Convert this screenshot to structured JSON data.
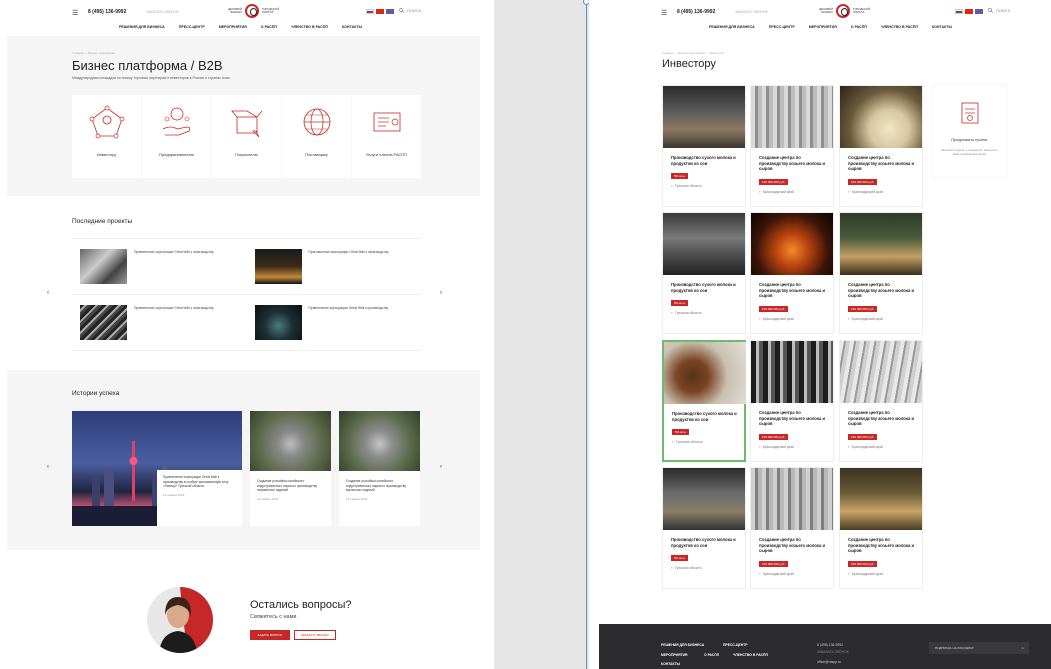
{
  "header": {
    "phone": "8 (495) 136-9992",
    "callback": "ЗАКАЗАТЬ ЗВОНОК",
    "logo_left": "ДЕЛОВОЙ БИЗНЕС",
    "logo_right": "ГОРОДСКОЙ ПОРТАЛ",
    "search": "ПОИСК",
    "nav": [
      "РЕШЕНИЯ ДЛЯ БИЗНЕСА",
      "ПРЕСС-ЦЕНТР",
      "МЕРОПРИЯТИЯ",
      "О РАСПП",
      "ЧЛЕНСТВО В РАСПП",
      "КОНТАКТЫ"
    ]
  },
  "left": {
    "breadcrumb": "Главная  —  Бизнес-платформа",
    "title": "Бизнес платформа / B2B",
    "lead": "Международная площадка по поиску торговых партнеров и инвесторов в России и странах Азии",
    "roles": [
      "Инвестору",
      "Предпринимателю",
      "Покупателю",
      "Поставщику",
      "Услуги членов РАСПП"
    ],
    "recent_title": "Последние проекты",
    "projects": [
      "Привлечение корпорации Great Wall к производству",
      "Приглашение корпорации Great Wall к производству",
      "Привлечение корпорации Great Wall к производству",
      "Привлечение корпорации Great Wall к производству"
    ],
    "stories_title": "Истории успеха",
    "story_big": "Привлечение корпорации Great Wall к производству в особую экономическую зону «Липецк» Тульской области",
    "story_big_date": "21 января 2022",
    "story_small": [
      {
        "text": "Создание российско-китайского индустриального парка по производству пальмистых изделий",
        "date": "21 января 2022"
      },
      {
        "text": "Создание российско-китайского индустриального парка по производству кирпичных изделий",
        "date": "21 января 2022"
      }
    ],
    "questions_title": "Остались вопросы?",
    "questions_sub": "Свяжитесь с нами",
    "btn_ask": "ЗАДАТЬ ВОПРОС",
    "btn_call": "ЗАКАЗАТЬ ЗВОНОК"
  },
  "right": {
    "breadcrumb": "Главная  —  Бизнес-платформа  —  Инвестору",
    "title": "Инвестору",
    "cards": [
      {
        "title": "Производство сухого молока и продуктов из сои",
        "price": "5% млн.",
        "location": "Тульская область"
      },
      {
        "title": "Создание центра по производству козьего молока и сыров",
        "price": "160 000 000 руб.",
        "location": "Краснодарский край"
      },
      {
        "title": "Создание центра по производству козьего молока и сыров",
        "price": "160 000 000 руб.",
        "location": "Краснодарский край"
      },
      {
        "title": "Производство сухого молока и продуктов из сои",
        "price": "5% млн.",
        "location": "Тульская область"
      },
      {
        "title": "Создание центра по производству козьего молока и сыров",
        "price": "160 000 000 руб.",
        "location": "Краснодарский край"
      },
      {
        "title": "Создание центра по производству козьего молока и сыров",
        "price": "160 000 000 руб.",
        "location": "Краснодарский край"
      },
      {
        "title": "Производство сухого молока и продуктов из сои",
        "price": "5% млн.",
        "location": "Тульская область"
      },
      {
        "title": "Создание центра по производству козьего молока и сыров",
        "price": "160 000 000 руб.",
        "location": "Краснодарский край"
      },
      {
        "title": "Создание центра по производству козьего молока и сыров",
        "price": "160 000 000 руб.",
        "location": "Краснодарский край"
      },
      {
        "title": "Производство сухого молока и продуктов из сои",
        "price": "5% млн.",
        "location": "Тульская область"
      },
      {
        "title": "Создание центра по производству козьего молока и сыров",
        "price": "160 000 000 руб.",
        "location": "Краснодарский край"
      },
      {
        "title": "Создание центра по производству козьего молока и сыров",
        "price": "160 000 000 руб.",
        "location": "Краснодарский край"
      }
    ],
    "offer_title": "Предложить проект",
    "offer_text": "Заполните форму, и специалист свяжется с вами в ближайшее время"
  },
  "footer": {
    "nav": [
      "РЕШЕНИЯ ДЛЯ БИЗНЕСА",
      "ПРЕСС-ЦЕНТР",
      "МЕРОПРИЯТИЯ",
      "О РАСПП",
      "ЧЛЕНСТВО В РАСПП",
      "КОНТАКТЫ"
    ],
    "phone": "8 (495) 136-9992",
    "callback": "ЗАКАЗАТЬ ЗВОНОК",
    "email": "office@raspp.ru",
    "subscribe": "ПОДПИСКА НА РАССЫЛКУ"
  },
  "colors": {
    "accent": "#c62828",
    "selection": "#6dbb6d",
    "footer": "#2c2c2e",
    "hero_bg": "#f5f5f6"
  }
}
